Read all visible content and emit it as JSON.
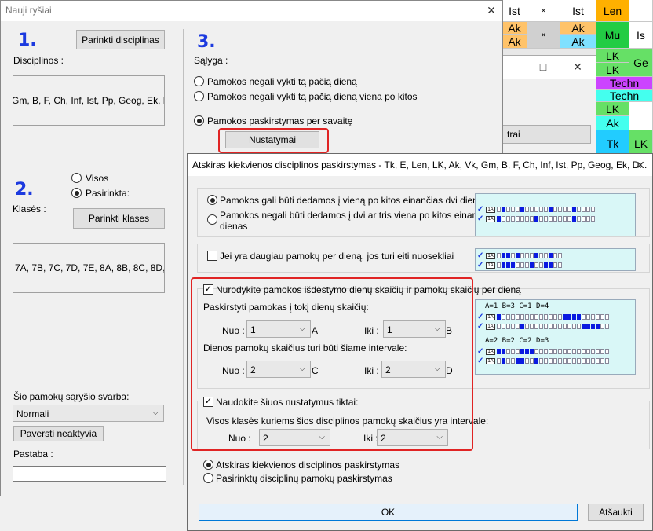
{
  "background_grid": {
    "cells": [
      {
        "id": "c1",
        "text": "Ist",
        "bg": "#ffffff"
      },
      {
        "id": "c2",
        "text": "×",
        "bg": "#ffffff"
      },
      {
        "id": "c3",
        "text": "Ist",
        "bg": "#ffffff"
      },
      {
        "id": "c4",
        "text": "Len",
        "bg": "#ffb000"
      },
      {
        "id": "c5",
        "text": "Ak",
        "bg": "#ffc36a"
      },
      {
        "id": "c6",
        "text": "Ak",
        "bg": "#ffc36a"
      },
      {
        "id": "c7",
        "text": "×",
        "bg": "#d0d0d0"
      },
      {
        "id": "c8",
        "text": "Ak",
        "bg": "#ffc36a"
      },
      {
        "id": "c9",
        "text": "Ak",
        "bg": "#7fe0ff"
      },
      {
        "id": "c10",
        "text": "Mu",
        "bg": "#22cc44"
      },
      {
        "id": "c11",
        "text": "Is",
        "bg": "#ffffff"
      },
      {
        "id": "c12",
        "text": "LK",
        "bg": "#66e066"
      },
      {
        "id": "c13",
        "text": "LK",
        "bg": "#66e066"
      },
      {
        "id": "c14",
        "text": "Ge",
        "bg": "#66e066"
      },
      {
        "id": "c15",
        "text": "Techn",
        "bg": "#cc44ff"
      },
      {
        "id": "c16",
        "text": "Techn",
        "bg": "#44ffee"
      },
      {
        "id": "c17",
        "text": "LK",
        "bg": "#66e066"
      },
      {
        "id": "c18",
        "text": "Ak",
        "bg": "#44ffee"
      },
      {
        "id": "c19",
        "text": "Tk",
        "bg": "#22ccff"
      },
      {
        "id": "c20",
        "text": "LK",
        "bg": "#66e066"
      }
    ]
  },
  "middle_window": {
    "maximize_icon": "□",
    "close_icon": "✕",
    "partial_button_label": "trai"
  },
  "main_dialog": {
    "title": "Nauji ryšiai",
    "close_icon": "✕",
    "steps": [
      "1.",
      "2.",
      "3."
    ],
    "disciplines_label": "Disciplinos :",
    "pick_disciplines_button": "Parinkti disciplinas",
    "disciplines_list": "Gm, B, F, Ch, Inf, Ist, Pp, Geog, Ek, Dail",
    "classes_label": "Klasės :",
    "radio_all": "Visos",
    "radio_selected": "Pasirinkta:",
    "pick_classes_button": "Parinkti klases",
    "classes_list": "7A, 7B, 7C, 7D, 7E, 8A, 8B, 8C, 8D, 8E",
    "importance_label": "Šio pamokų sąryšio svarba:",
    "importance_value": "Normali",
    "make_inactive_button": "Paversti neaktyvia",
    "note_label": "Pastaba :",
    "note_value": "",
    "condition_label": "Sąlyga :",
    "cond_option_1": "Pamokos negali vykti tą pačią dieną",
    "cond_option_2": "Pamokos negali vykti tą pačią dieną viena po kitos",
    "cond_option_3": "Pamokos paskirstymas per savaitę",
    "settings_button": "Nustatymai"
  },
  "settings_dialog": {
    "title": "Atskiras kiekvienos disciplinos paskirstymas - Tk, E, Len, LK, Ak, Vk, Gm, B, F, Ch, Inf, Ist, Pp, Geog, Ek, D...",
    "close_icon": "✕",
    "opt_consecutive_days": "Pamokos gali būti dedamos į vieną po kitos einančias dvi dienas",
    "opt_no_consecutive_line1": "Pamokos negali būti dedamos į dvi ar tris viena po kitos einančias",
    "opt_no_consecutive_line2": "dienas",
    "chk_sequential": "Jei yra daugiau pamokų per dieną, jos turi eiti nuosekliai",
    "chk_specify": "Nurodykite pamokos išdėstymo dienų skaičių ir pamokų skaičių per dieną",
    "distribute_days_label": "Paskirstyti pamokas į tokį dienų skaičių:",
    "from_label": "Nuo :",
    "to_label": "Iki :",
    "days_from": "1",
    "days_from_letter": "A",
    "days_to": "1",
    "days_to_letter": "B",
    "per_day_label": "Dienos pamokų skaičius turi būti šiame intervale:",
    "per_day_from": "2",
    "per_day_from_letter": "C",
    "per_day_to": "2",
    "per_day_to_letter": "D",
    "chk_only_if": "Naudokite šiuos nustatymus tiktai:",
    "class_lessons_label": "Visos klasės kuriems šios disciplinos pamokų skaičius yra intervale:",
    "class_from": "2",
    "class_to": "2",
    "radio_separate": "Atskiras kiekvienos disciplinos paskirstymas",
    "radio_selected": "Pasirinktų disciplinų pamokų paskirstymas",
    "ok_button": "OK",
    "cancel_button": "Atšaukti",
    "preview_caption_1": "A=1 B=3 C=1 D=4",
    "preview_caption_2": "A=2 B=2 C=2 D=3",
    "preview_badge": "1A",
    "colors": {
      "highlight_red": "#e02424",
      "step_blue": "#1c3adf",
      "preview_bg": "#d9f7f7",
      "fill_blue": "#0a1ae0"
    }
  }
}
